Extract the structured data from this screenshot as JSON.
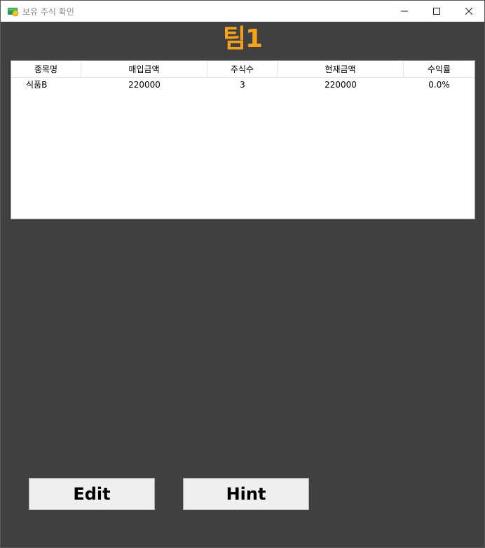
{
  "window": {
    "title": "보유 주식 확인",
    "icon": "stock-app-icon"
  },
  "header": {
    "team_title": "팀1",
    "accent_color": "#f7a21b"
  },
  "table": {
    "columns": [
      "종목명",
      "매입금액",
      "주식수",
      "현재금액",
      "수익률"
    ],
    "rows": [
      [
        "식품B",
        "220000",
        "3",
        "220000",
        "0.0%"
      ]
    ]
  },
  "buttons": {
    "edit_label": "Edit",
    "hint_label": "Hint"
  }
}
